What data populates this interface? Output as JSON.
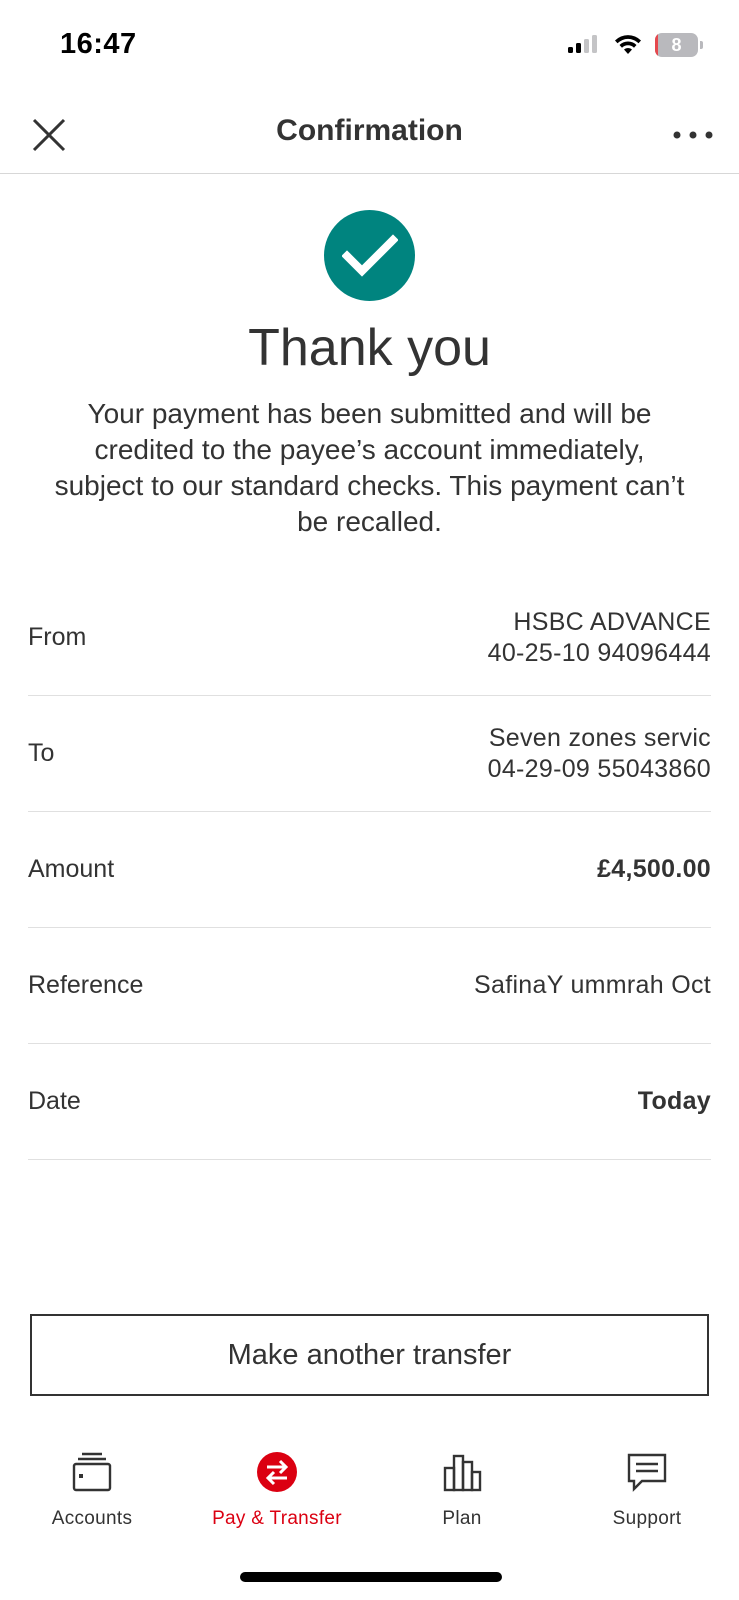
{
  "status_bar": {
    "time": "16:47",
    "battery_level": "8",
    "icons": [
      "signal-icon",
      "wifi-icon",
      "battery-icon"
    ]
  },
  "header": {
    "title": "Confirmation",
    "close_icon": "close-icon",
    "more_icon": "more-options-icon"
  },
  "success": {
    "icon": "checkmark-icon",
    "title": "Thank you",
    "message": "Your payment has been submitted and will be credited to the payee’s account immediately, subject to our standard checks. This payment can’t be recalled."
  },
  "details": [
    {
      "label": "From",
      "value_line1": "HSBC ADVANCE",
      "value_line2": "40-25-10 94096444"
    },
    {
      "label": "To",
      "value_line1": "Seven zones servic",
      "value_line2": "04-29-09 55043860"
    },
    {
      "label": "Amount",
      "value_line1": "£4,500.00",
      "value_line2": ""
    },
    {
      "label": "Reference",
      "value_line1": "SafinaY ummrah Oct",
      "value_line2": ""
    },
    {
      "label": "Date",
      "value_line1": "Today",
      "value_line2": ""
    }
  ],
  "actions": {
    "make_another_label": "Make another transfer"
  },
  "tab_bar": {
    "items": [
      {
        "label": "Accounts",
        "icon": "wallet-icon",
        "active": false
      },
      {
        "label": "Pay & Transfer",
        "icon": "transfer-icon",
        "active": true
      },
      {
        "label": "Plan",
        "icon": "bar-chart-icon",
        "active": false
      },
      {
        "label": "Support",
        "icon": "chat-icon",
        "active": false
      }
    ]
  },
  "colors": {
    "success_green": "#00847f",
    "brand_red": "#db0011",
    "text": "#333333"
  }
}
